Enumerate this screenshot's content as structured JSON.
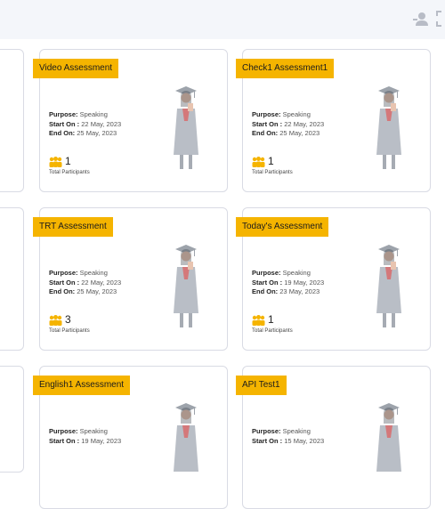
{
  "topbar": {
    "icons": [
      "user-switch-icon",
      "fullscreen-icon"
    ]
  },
  "cards": [
    {
      "title": "Video Assessment",
      "purpose_label": "Purpose:",
      "purpose": "Speaking",
      "start_label": "Start On :",
      "start": "22 May, 2023",
      "end_label": "End On:",
      "end": "25 May, 2023",
      "participants": "1",
      "participants_label": "Total Participants"
    },
    {
      "title": "Check1 Assessment1",
      "purpose_label": "Purpose:",
      "purpose": "Speaking",
      "start_label": "Start On :",
      "start": "22 May, 2023",
      "end_label": "End On:",
      "end": "25 May, 2023",
      "participants": "1",
      "participants_label": "Total Participants"
    },
    {
      "title": "TRT Assessment",
      "purpose_label": "Purpose:",
      "purpose": "Speaking",
      "start_label": "Start On :",
      "start": "22 May, 2023",
      "end_label": "End On:",
      "end": "25 May, 2023",
      "participants": "3",
      "participants_label": "Total Participants"
    },
    {
      "title": "Today's Assessment",
      "purpose_label": "Purpose:",
      "purpose": "Speaking",
      "start_label": "Start On :",
      "start": "19 May, 2023",
      "end_label": "End On:",
      "end": "23 May, 2023",
      "participants": "1",
      "participants_label": "Total Participants"
    },
    {
      "title": "English1 Assessment",
      "purpose_label": "Purpose:",
      "purpose": "Speaking",
      "start_label": "Start On :",
      "start": "19 May, 2023"
    },
    {
      "title": "API Test1",
      "purpose_label": "Purpose:",
      "purpose": "Speaking",
      "start_label": "Start On :",
      "start": "15 May, 2023"
    }
  ]
}
